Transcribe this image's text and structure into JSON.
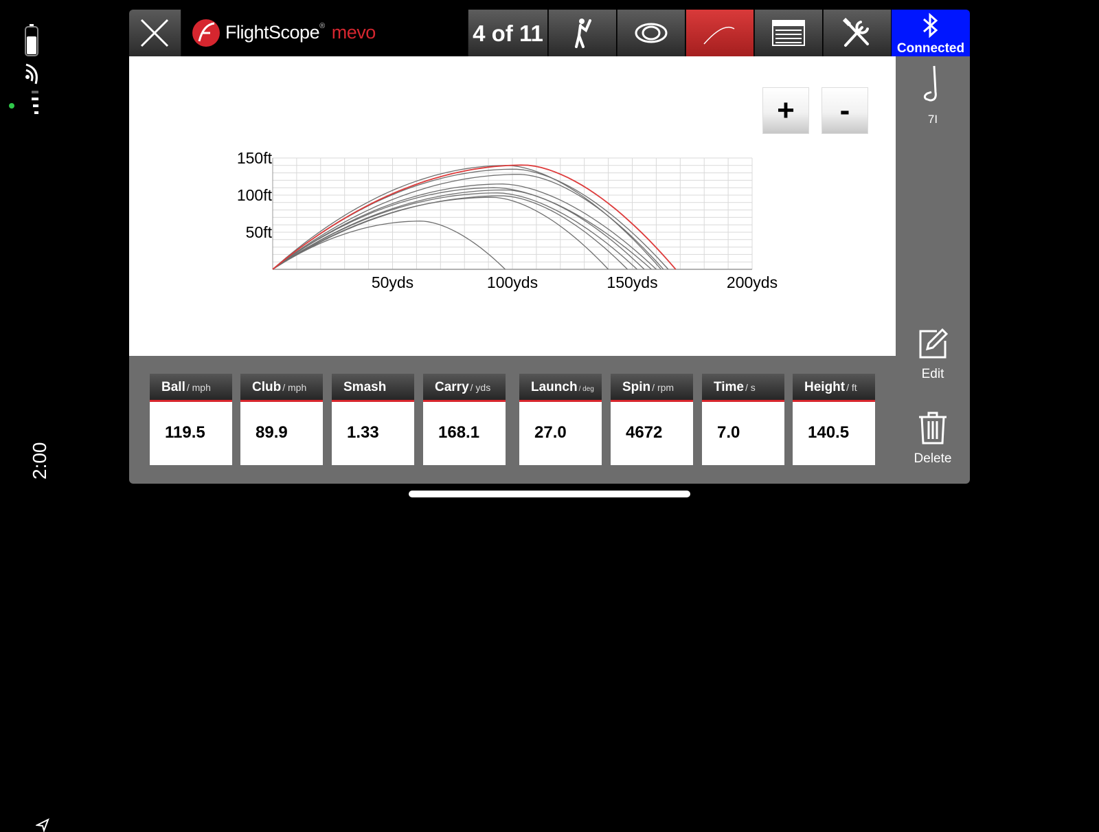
{
  "status": {
    "time": "2:00"
  },
  "header": {
    "brand": "FlightScope",
    "brand_sub": "mevo",
    "shot_counter": "4 of 11",
    "connection_label": "Connected"
  },
  "icons": {
    "close": "close-icon",
    "golfer": "golfer-icon",
    "eye": "eye-icon",
    "trajectory": "trajectory-icon",
    "table": "table-icon",
    "tools": "tools-icon",
    "bluetooth": "bluetooth-icon",
    "club": "golf-club-icon",
    "edit": "edit-icon",
    "delete": "trash-icon"
  },
  "zoom": {
    "in_label": "+",
    "out_label": "-"
  },
  "sidebar": {
    "club": "7I",
    "edit_label": "Edit",
    "delete_label": "Delete"
  },
  "metrics": [
    {
      "name": "Ball",
      "unit": "/ mph",
      "value": "119.5"
    },
    {
      "name": "Club",
      "unit": "/ mph",
      "value": "89.9"
    },
    {
      "name": "Smash",
      "unit": "",
      "value": "1.33"
    },
    {
      "name": "Carry",
      "unit": "/ yds",
      "value": "168.1"
    },
    {
      "name": "Launch",
      "unit": "/ deg",
      "value": "27.0"
    },
    {
      "name": "Spin",
      "unit": "/ rpm",
      "value": "4672"
    },
    {
      "name": "Time",
      "unit": "/ s",
      "value": "7.0"
    },
    {
      "name": "Height",
      "unit": "/ ft",
      "value": "140.5"
    }
  ],
  "colors": {
    "accent_red": "#d8262d",
    "bluetooth_blue": "#0016ff",
    "shot_line": "#6f6f6f",
    "selected_shot_line": "#dd3a3a"
  },
  "chart_data": {
    "type": "line",
    "title": "",
    "xlabel": "",
    "ylabel": "",
    "xlim": [
      0,
      200
    ],
    "ylim": [
      0,
      150
    ],
    "x_ticks": [
      {
        "value": 50,
        "label": "50yds"
      },
      {
        "value": 100,
        "label": "100yds"
      },
      {
        "value": 150,
        "label": "150yds"
      },
      {
        "value": 200,
        "label": "200yds"
      }
    ],
    "y_ticks": [
      {
        "value": 50,
        "label": "50ft"
      },
      {
        "value": 100,
        "label": "100ft"
      },
      {
        "value": 150,
        "label": "150ft"
      }
    ],
    "grid": true,
    "selected_index": 3,
    "series": [
      {
        "carry": 97,
        "apex_x": 62,
        "apex": 65
      },
      {
        "carry": 140,
        "apex_x": 92,
        "apex": 97
      },
      {
        "carry": 148,
        "apex_x": 96,
        "apex": 99
      },
      {
        "carry": 168.1,
        "apex_x": 105,
        "apex": 140.5
      },
      {
        "carry": 152,
        "apex_x": 94,
        "apex": 103
      },
      {
        "carry": 155,
        "apex_x": 97,
        "apex": 107
      },
      {
        "carry": 158,
        "apex_x": 93,
        "apex": 110
      },
      {
        "carry": 160,
        "apex_x": 96,
        "apex": 115
      },
      {
        "carry": 163,
        "apex_x": 103,
        "apex": 128
      },
      {
        "carry": 165,
        "apex_x": 101,
        "apex": 135
      },
      {
        "carry": 162,
        "apex_x": 98,
        "apex": 140
      }
    ]
  }
}
